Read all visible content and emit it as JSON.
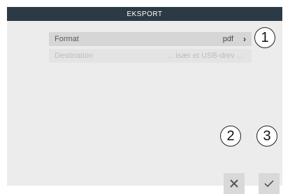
{
  "header": {
    "title": "EKSPORT"
  },
  "rows": [
    {
      "label": "Format",
      "value": "pdf",
      "chevron_icon": "chevron-right-icon"
    },
    {
      "label": "Destination",
      "value": "... især et USB-drev ..."
    }
  ],
  "callouts": [
    "1",
    "2",
    "3"
  ],
  "buttons": {
    "cancel_icon": "close-icon",
    "confirm_icon": "checkmark-icon"
  },
  "colors": {
    "titlebar": "#2b3a44",
    "screen_bg": "#ececec",
    "row_selected": "#d6d6d6",
    "button_bg": "#d9d9d9"
  }
}
